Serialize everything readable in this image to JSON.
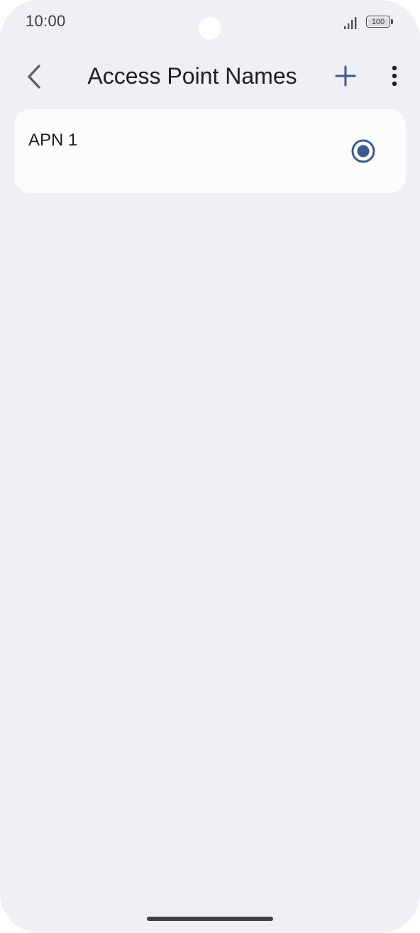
{
  "status_bar": {
    "time": "10:00",
    "battery_level": "100"
  },
  "app_bar": {
    "title": "Access Point Names",
    "icons": {
      "back": "chevron-left-icon",
      "add": "plus-icon",
      "more": "more-vertical-icon"
    }
  },
  "apn_list": [
    {
      "name": "APN 1",
      "selected": true
    }
  ],
  "colors": {
    "background": "#efeff4",
    "card": "#fcfcfd",
    "accent": "#3d5a8f",
    "text_primary": "#1f1f23"
  }
}
